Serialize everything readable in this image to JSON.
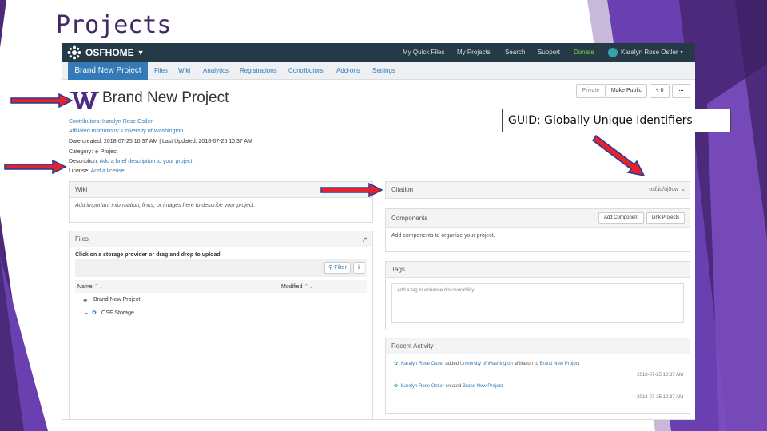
{
  "slide": {
    "title": "Projects",
    "annotation": "GUID: Globally Unique Identifiers",
    "colors": {
      "purple_dark": "#4b2a7b",
      "purple_light": "#7c4fc2",
      "arrow_red": "#e3222b",
      "arrow_blue": "#1f3d9b"
    }
  },
  "osf": {
    "brand": "OSFHOME",
    "top_nav": [
      "My Quick Files",
      "My Projects",
      "Search",
      "Support",
      "Donate"
    ],
    "user": "Karalyn Rose Ostler",
    "project_tab": "Brand New Project",
    "sub_nav": [
      "Files",
      "Wiki",
      "Analytics",
      "Registrations",
      "Contributors",
      "Add-ons",
      "Settings"
    ],
    "buttons": {
      "privacy": "Private",
      "make_public": "Make Public",
      "fork_count": "0",
      "more": "..."
    },
    "project": {
      "title": "Brand New Project",
      "contributors_label": "Contributors:",
      "contributors": "Karalyn Rose Ostler",
      "institutions_label": "Affiliated Institutions:",
      "institutions": "University of Washington",
      "dates": "Date created: 2018-07-25 10:37 AM | Last Updated: 2018-07-25 10:37 AM",
      "category_label": "Category:",
      "category": "Project",
      "description_label": "Description:",
      "description": "Add a brief description to your project",
      "license_label": "License:",
      "license": "Add a license"
    },
    "wiki": {
      "title": "Wiki",
      "body": "Add important information, links, or images here to describe your project."
    },
    "files": {
      "title": "Files",
      "hint": "Click on a storage provider or drag and drop to upload",
      "filter": "Filter",
      "col_name": "Name",
      "col_modified": "Modified",
      "rows": [
        "Brand New Project",
        "OSF Storage"
      ]
    },
    "citation": {
      "title": "Citation",
      "link": "osf.io/uj5cw"
    },
    "components": {
      "title": "Components",
      "add": "Add Component",
      "link": "Link Projects",
      "body": "Add components to organize your project."
    },
    "tags": {
      "title": "Tags",
      "placeholder": "Add a tag to enhance discoverability"
    },
    "activity": {
      "title": "Recent Activity",
      "items": [
        {
          "actor": "Karalyn Rose Ostler",
          "verb1": "added",
          "obj1": "University of Washington",
          "verb2": "affiliation to",
          "obj2": "Brand New Project",
          "time": "2018-07-25 10:37 AM"
        },
        {
          "actor": "Karalyn Rose Ostler",
          "verb1": "created",
          "obj1": "Brand New Project",
          "verb2": "",
          "obj2": "",
          "time": "2018-07-25 10:37 AM"
        }
      ]
    }
  }
}
